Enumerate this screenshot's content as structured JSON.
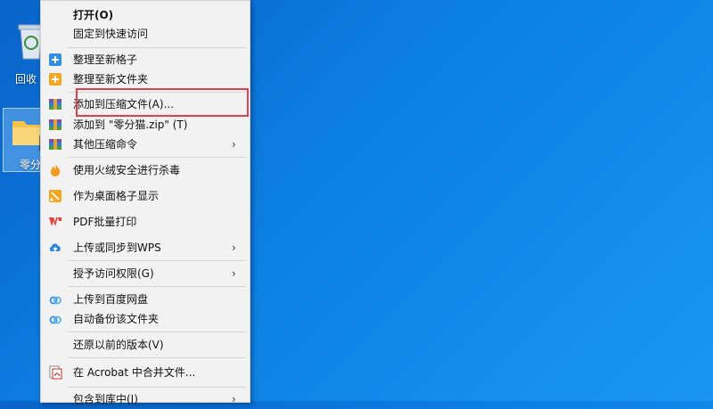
{
  "desktop": {
    "recycle_bin_label": "回收",
    "folder_label": "零分"
  },
  "menu": {
    "items": [
      {
        "label": "打开(O)",
        "icon": "none"
      },
      {
        "label": "固定到快速访问",
        "icon": "none"
      },
      {
        "label": "整理至新格子",
        "icon": "blue-plus-icon"
      },
      {
        "label": "整理至新文件夹",
        "icon": "orange-plus-icon"
      },
      {
        "label": "添加到压缩文件(A)...",
        "icon": "archive-icon"
      },
      {
        "label": "添加到 \"零分猫.zip\" (T)",
        "icon": "archive-icon"
      },
      {
        "label": "其他压缩命令",
        "icon": "archive-icon",
        "submenu": "›"
      },
      {
        "label": "使用火绒安全进行杀毒",
        "icon": "huorong-icon"
      },
      {
        "label": "作为桌面格子显示",
        "icon": "grid-icon"
      },
      {
        "label": "PDF批量打印",
        "icon": "wps-pdf-icon"
      },
      {
        "label": "上传或同步到WPS",
        "icon": "cloud-upload-icon",
        "submenu": "›"
      },
      {
        "label": "授予访问权限(G)",
        "icon": "none",
        "submenu": "›"
      },
      {
        "label": "上传到百度网盘",
        "icon": "baidu-cloud-icon"
      },
      {
        "label": "自动备份该文件夹",
        "icon": "baidu-cloud-icon"
      },
      {
        "label": "还原以前的版本(V)",
        "icon": "none"
      },
      {
        "label": "在 Acrobat 中合并文件...",
        "icon": "acrobat-icon"
      },
      {
        "label": "包含到库中(I)",
        "icon": "none",
        "submenu": "›"
      }
    ]
  },
  "colors": {
    "desktop_bg": "#0c7fe3",
    "menu_bg": "#f2f2f2",
    "highlight_border": "#e0404a"
  }
}
